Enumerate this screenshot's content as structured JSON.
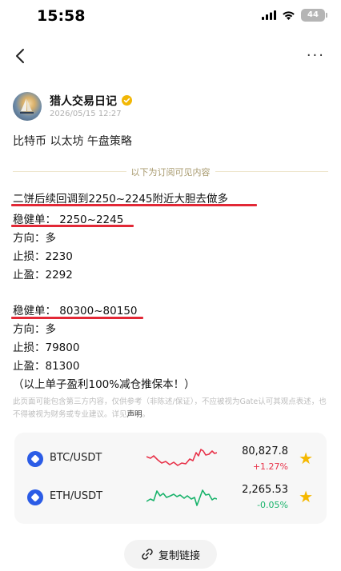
{
  "status_bar": {
    "time": "15:58",
    "battery": "44"
  },
  "author": {
    "name": "猎人交易日记",
    "date": "2026/05/15 12:27"
  },
  "post": {
    "title": "比特币 以太坊 午盘策略",
    "divider": "以下为订阅可见内容",
    "lines": [
      "二饼后续回调到2250~2245附近大胆去做多",
      "稳健单： 2250~2245",
      "方向：多",
      "止损：2230",
      "止盈：2292",
      "稳健单： 80300~80150",
      "方向：多",
      "止损：79800",
      "止盈：81300",
      "（以上单子盈利100%减仓推保本！）"
    ]
  },
  "disclaimer": {
    "text": "此页面可能包含第三方内容，仅供参考（非陈述/保证），不应被视为Gate认可其观点表述，也不得被视为财务或专业建议。详见",
    "link": "声明",
    "end": "。"
  },
  "market": [
    {
      "pair": "BTC/USDT",
      "price": "80,827.8",
      "change": "+1.27%",
      "trend": "up",
      "color": "#e8334a"
    },
    {
      "pair": "ETH/USDT",
      "price": "2,265.53",
      "change": "-0.05%",
      "trend": "down",
      "color": "#19b36b"
    }
  ],
  "copy_button": "复制链接",
  "icons": [
    "back-icon",
    "more-icon",
    "verified-icon",
    "star-icon",
    "link-icon"
  ]
}
